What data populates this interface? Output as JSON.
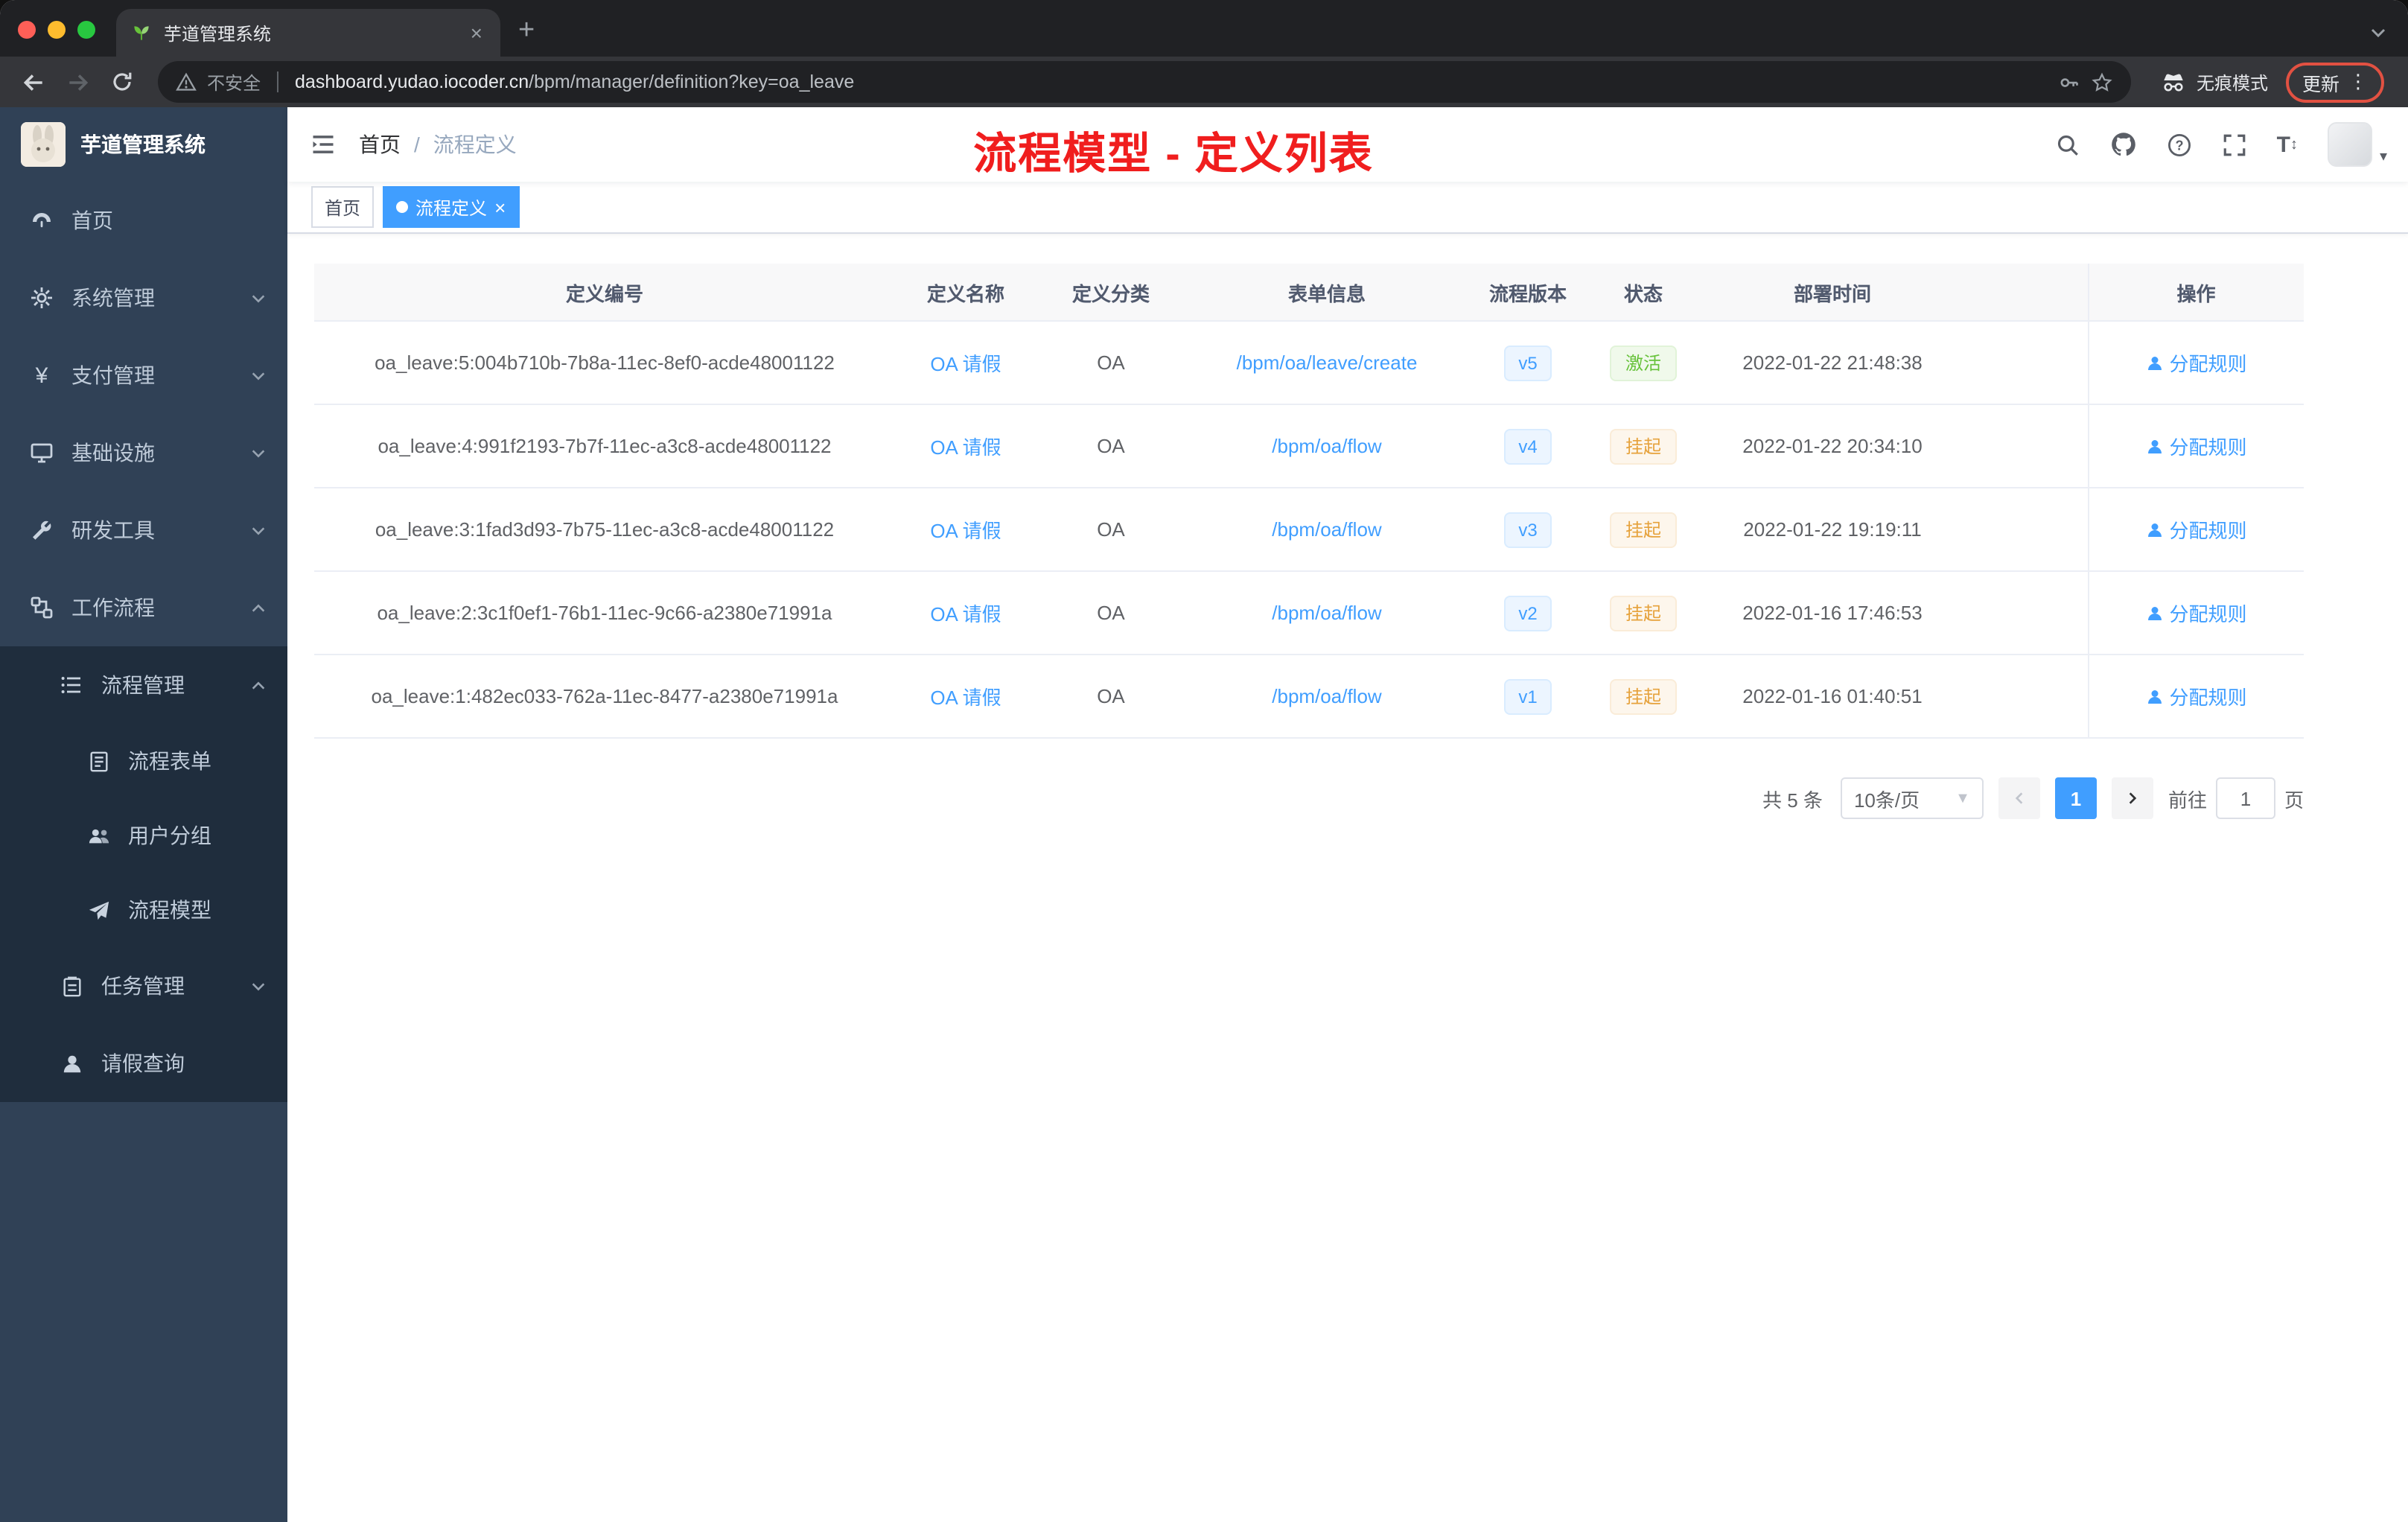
{
  "browser": {
    "tab_title": "芋道管理系统",
    "security_label": "不安全",
    "url_host": "dashboard.yudao.iocoder.cn",
    "url_path": "/bpm/manager/definition?key=oa_leave",
    "incognito_label": "无痕模式",
    "update_label": "更新",
    "menu_dots": "⋮",
    "new_tab_label": "+",
    "tab_close": "×"
  },
  "sidebar": {
    "logo_title": "芋道管理系统",
    "items": [
      {
        "label": "首页"
      },
      {
        "label": "系统管理"
      },
      {
        "label": "支付管理"
      },
      {
        "label": "基础设施"
      },
      {
        "label": "研发工具"
      },
      {
        "label": "工作流程"
      },
      {
        "label": "流程管理"
      },
      {
        "label": "流程表单"
      },
      {
        "label": "用户分组"
      },
      {
        "label": "流程模型"
      },
      {
        "label": "任务管理"
      },
      {
        "label": "请假查询"
      }
    ]
  },
  "header": {
    "breadcrumb_home": "首页",
    "breadcrumb_separator": "/",
    "breadcrumb_current": "流程定义",
    "annotation": "流程模型 - 定义列表"
  },
  "tags": {
    "home": "首页",
    "active": "流程定义",
    "close": "×"
  },
  "table": {
    "headers": [
      "定义编号",
      "定义名称",
      "定义分类",
      "表单信息",
      "流程版本",
      "状态",
      "部署时间",
      "操作"
    ],
    "action_label": "分配规则",
    "rows": [
      {
        "id": "oa_leave:5:004b710b-7b8a-11ec-8ef0-acde48001122",
        "name": "OA 请假",
        "category": "OA",
        "form": "/bpm/oa/leave/create",
        "version": "v5",
        "status": "激活",
        "status_type": "success",
        "time": "2022-01-22 21:48:38"
      },
      {
        "id": "oa_leave:4:991f2193-7b7f-11ec-a3c8-acde48001122",
        "name": "OA 请假",
        "category": "OA",
        "form": "/bpm/oa/flow",
        "version": "v4",
        "status": "挂起",
        "status_type": "warning",
        "time": "2022-01-22 20:34:10"
      },
      {
        "id": "oa_leave:3:1fad3d93-7b75-11ec-a3c8-acde48001122",
        "name": "OA 请假",
        "category": "OA",
        "form": "/bpm/oa/flow",
        "version": "v3",
        "status": "挂起",
        "status_type": "warning",
        "time": "2022-01-22 19:19:11"
      },
      {
        "id": "oa_leave:2:3c1f0ef1-76b1-11ec-9c66-a2380e71991a",
        "name": "OA 请假",
        "category": "OA",
        "form": "/bpm/oa/flow",
        "version": "v2",
        "status": "挂起",
        "status_type": "warning",
        "time": "2022-01-16 17:46:53"
      },
      {
        "id": "oa_leave:1:482ec033-762a-11ec-8477-a2380e71991a",
        "name": "OA 请假",
        "category": "OA",
        "form": "/bpm/oa/flow",
        "version": "v1",
        "status": "挂起",
        "status_type": "warning",
        "time": "2022-01-16 01:40:51"
      }
    ]
  },
  "pagination": {
    "total": "共 5 条",
    "page_size": "10条/页",
    "current_page": "1",
    "goto_label": "前往",
    "goto_value": "1",
    "page_unit": "页"
  },
  "colors": {
    "accent_blue": "#409eff",
    "success_green": "#67c23a",
    "warning_orange": "#e6a23c",
    "annotation_red": "#f01e1e",
    "sidebar_bg": "#304156",
    "submenu_bg": "#1f2d3d",
    "chrome_dark": "#202124",
    "toolbar_dark": "#35363a"
  }
}
